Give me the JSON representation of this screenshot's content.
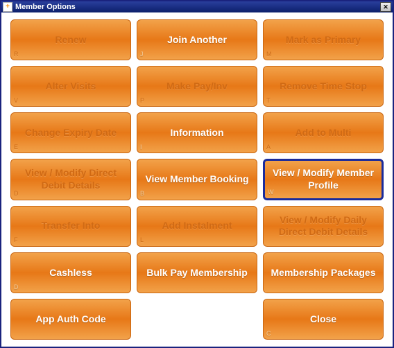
{
  "titlebar": {
    "icon_glyph": "+",
    "title": "Member Options",
    "close_glyph": "✕"
  },
  "buttons": [
    {
      "label": "Renew",
      "shortcut": "R",
      "state": "dim"
    },
    {
      "label": "Join Another",
      "shortcut": "J",
      "state": "active"
    },
    {
      "label": "Mark as Primary",
      "shortcut": "M",
      "state": "dim"
    },
    {
      "label": "Alter Visits",
      "shortcut": "V",
      "state": "dim"
    },
    {
      "label": "Make Pay/Inv",
      "shortcut": "P",
      "state": "dim"
    },
    {
      "label": "Remove Time Stop",
      "shortcut": "T",
      "state": "dim"
    },
    {
      "label": "Change Expiry Date",
      "shortcut": "E",
      "state": "dim"
    },
    {
      "label": "Information",
      "shortcut": "I",
      "state": "active"
    },
    {
      "label": "Add to Multi",
      "shortcut": "A",
      "state": "dim"
    },
    {
      "label": "View / Modify Direct Debit Details",
      "shortcut": "D",
      "state": "dim"
    },
    {
      "label": "View Member Booking",
      "shortcut": "B",
      "state": "active"
    },
    {
      "label": "View / Modify Member Profile",
      "shortcut": "W",
      "state": "selected"
    },
    {
      "label": "Transfer Into",
      "shortcut": "F",
      "state": "dim"
    },
    {
      "label": "Add Instalment",
      "shortcut": "L",
      "state": "dim"
    },
    {
      "label": "View / Modify Daily Direct Debit Details",
      "shortcut": "",
      "state": "dim"
    },
    {
      "label": "Cashless",
      "shortcut": "D",
      "state": "active"
    },
    {
      "label": "Bulk Pay Membership",
      "shortcut": "",
      "state": "active"
    },
    {
      "label": "Membership Packages",
      "shortcut": "",
      "state": "active"
    },
    {
      "label": "App Auth Code",
      "shortcut": "",
      "state": "active"
    },
    {
      "label": "",
      "shortcut": "",
      "state": "placeholder"
    },
    {
      "label": "Close",
      "shortcut": "C",
      "state": "active"
    }
  ]
}
